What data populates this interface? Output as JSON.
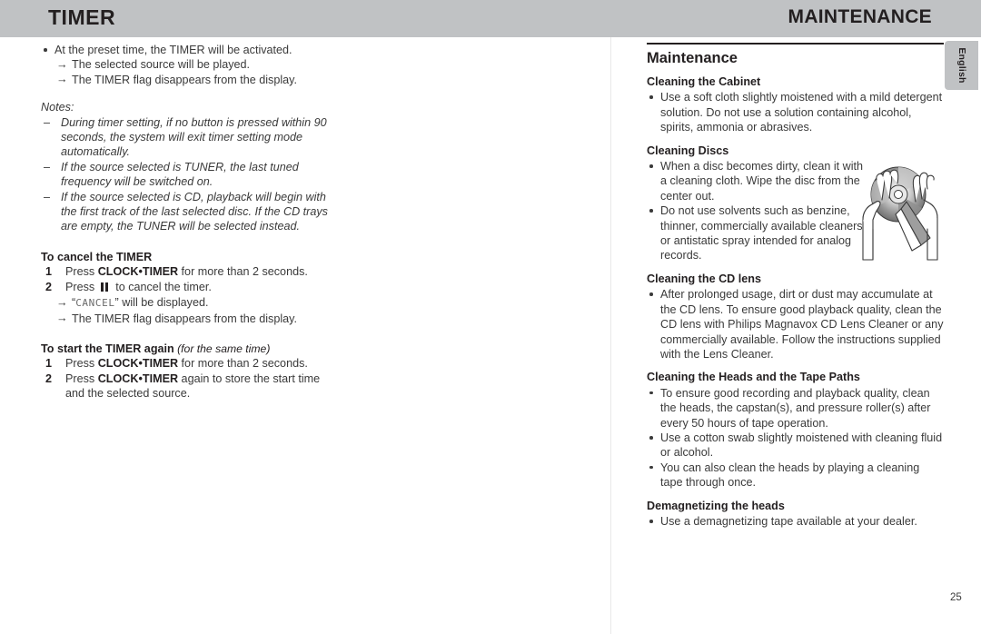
{
  "header": {
    "left_title": "TIMER",
    "right_title": "MAINTENANCE"
  },
  "language_tab": {
    "label": "English"
  },
  "page_number": "25",
  "left_column": {
    "timer_activation": {
      "bullet": "At the preset time, the TIMER will be activated.",
      "arrows": [
        "The selected source will be played.",
        "The TIMER flag disappears from the display."
      ]
    },
    "notes": {
      "label": "Notes:",
      "items": [
        "During timer setting,  if no button is pressed within 90 seconds, the system will exit timer setting mode automatically.",
        "If the source selected is TUNER, the last tuned frequency will be switched on.",
        "If the source selected is CD, playback will begin with the first track of the last selected disc. If the CD trays are empty, the TUNER will be selected instead."
      ]
    },
    "cancel_timer": {
      "heading": "To cancel the TIMER",
      "step1_num": "1",
      "step1_pre": "Press ",
      "step1_key": "CLOCK•TIMER",
      "step1_post": " for more than 2 seconds.",
      "step2_num": "2",
      "step2_pre": "Press ",
      "step2_icon": "pause-icon",
      "step2_post": " to cancel the timer.",
      "arrow1_quote_open": "“",
      "arrow1_lcd": "CANCEL",
      "arrow1_quote_close": "”",
      "arrow1_rest": " will be displayed.",
      "arrow2": "The TIMER flag disappears from the display."
    },
    "restart_timer": {
      "heading_bold": "To start the TIMER again",
      "heading_italic": " (for the same time)",
      "step1_num": "1",
      "step1_pre": "Press ",
      "step1_key": "CLOCK•TIMER",
      "step1_post": " for more than 2 seconds.",
      "step2_num": "2",
      "step2_pre": "Press ",
      "step2_key": "CLOCK•TIMER",
      "step2_post": " again to store the start time and the selected source."
    }
  },
  "right_column": {
    "section_title": "Maintenance",
    "cleaning_cabinet": {
      "heading": "Cleaning the Cabinet",
      "bullets": [
        "Use a soft cloth slightly moistened with a mild detergent solution. Do not use a solution containing alcohol, spirits, ammonia or abrasives."
      ]
    },
    "cleaning_discs": {
      "heading": "Cleaning Discs",
      "bullets": [
        "When a disc becomes dirty, clean it with a cleaning cloth. Wipe the disc from the center out.",
        "Do not use solvents such as benzine, thinner, commercially available cleaners, or antistatic spray intended for analog records."
      ]
    },
    "cleaning_cd_lens": {
      "heading": "Cleaning the CD lens",
      "bullets": [
        "After prolonged usage, dirt or dust may accumulate at the CD lens. To ensure good playback quality, clean the CD lens with Philips Magnavox CD Lens Cleaner or any commercially available. Follow the instructions supplied with the Lens Cleaner."
      ]
    },
    "cleaning_heads": {
      "heading": "Cleaning the Heads and the Tape Paths",
      "bullets": [
        "To ensure good recording and playback quality, clean the heads, the capstan(s), and pressure roller(s) after every 50 hours of tape operation.",
        "Use a cotton swab slightly moistened with cleaning fluid or alcohol.",
        "You can also clean the heads by playing a cleaning tape through once."
      ]
    },
    "demagnetizing": {
      "heading": "Demagnetizing the heads",
      "bullets": [
        "Use a demagnetizing tape available at your dealer."
      ]
    },
    "illustration_name": "hands-cleaning-cd-illustration"
  }
}
